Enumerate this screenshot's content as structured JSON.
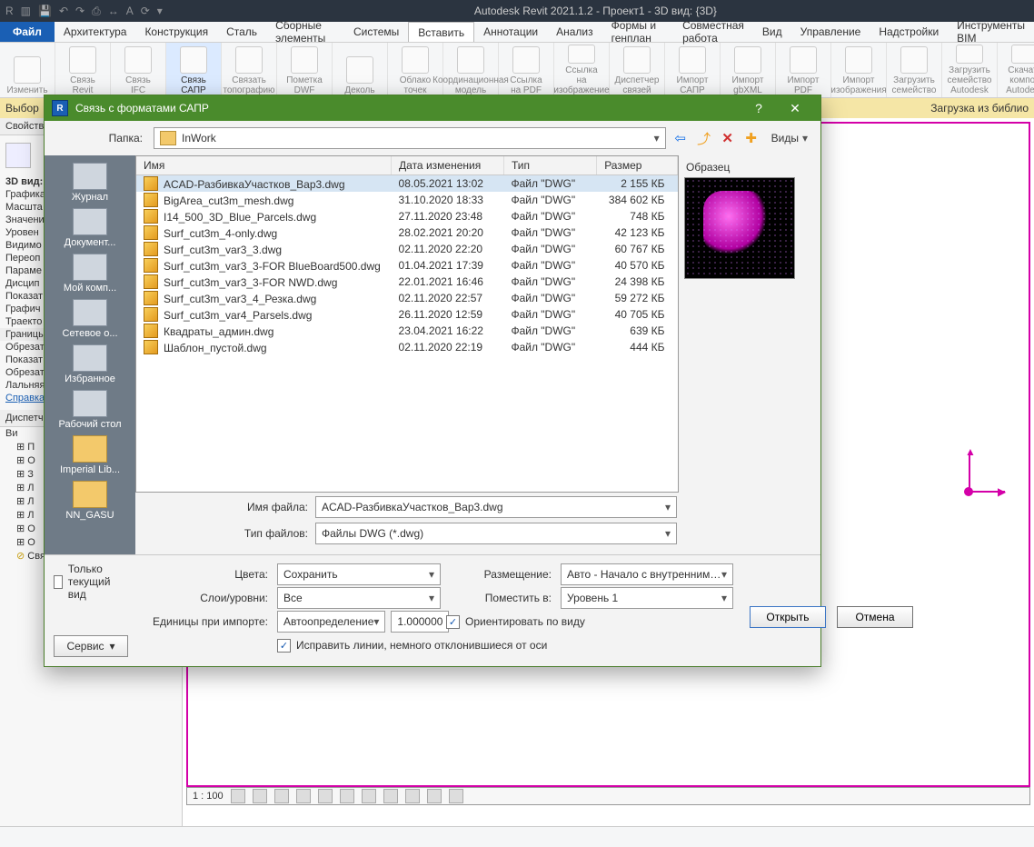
{
  "app_title": "Autodesk Revit 2021.1.2 - Проект1 - 3D вид: {3D}",
  "menu_file": "Файл",
  "menu_tabs": [
    "Архитектура",
    "Конструкция",
    "Сталь",
    "Сборные элементы",
    "Системы",
    "Вставить",
    "Аннотации",
    "Анализ",
    "Формы и генплан",
    "Совместная работа",
    "Вид",
    "Управление",
    "Надстройки",
    "Инструменты BIM"
  ],
  "menu_active_index": 5,
  "ribbon_items": [
    "Изменить",
    "Связь Revit",
    "Связь IFC",
    "Связь САПР",
    "Связать топографию",
    "Пометка DWF",
    "Деколь",
    "Облако точек",
    "Координационная модель",
    "Ссылка на PDF",
    "Ссылка на изображение",
    "Диспетчер связей",
    "Импорт САПР",
    "Импорт gbXML",
    "Импорт PDF",
    "Импорт изображения",
    "Загрузить семейство",
    "Загрузить семейство Autodesk",
    "Скачать компон Autodesk"
  ],
  "ribbon_active_index": 3,
  "options_bar_left": "Выбор",
  "options_bar_right": "Загрузка из библио",
  "left_panel": {
    "props_header": "Свойства",
    "view_label": "3D вид:",
    "rows": [
      "Графика",
      "Масшта",
      "Значени",
      "Уровен",
      "Видимо",
      "Переоп",
      "Параме",
      "Дисцип",
      "Показат",
      "Графич",
      "Траекто"
    ],
    "section": "Границы",
    "rows2": [
      "Обрезат",
      "Показат",
      "Обрезат",
      "Лальняя"
    ],
    "help_link": "Справка",
    "dispatch": "Диспетч",
    "tree_header": "Ви",
    "tree_nodes": [
      "П",
      "О",
      "З",
      "Л",
      "Л",
      "Л",
      "О",
      "О"
    ],
    "linked_label": "Связанные файлы Revit"
  },
  "view_scale": "1 : 100",
  "dialog": {
    "title": "Связь с форматами САПР",
    "folder_label": "Папка:",
    "folder_value": "InWork",
    "views_label": "Виды",
    "columns": [
      "Имя",
      "Дата изменения",
      "Тип",
      "Размер"
    ],
    "files": [
      {
        "name": "ACAD-РазбивкаУчастков_Вар3.dwg",
        "date": "08.05.2021 13:02",
        "type": "Файл \"DWG\"",
        "size": "2 155 КБ",
        "sel": true
      },
      {
        "name": "BigArea_cut3m_mesh.dwg",
        "date": "31.10.2020 18:33",
        "type": "Файл \"DWG\"",
        "size": "384 602 КБ"
      },
      {
        "name": "I14_500_3D_Blue_Parcels.dwg",
        "date": "27.11.2020 23:48",
        "type": "Файл \"DWG\"",
        "size": "748 КБ"
      },
      {
        "name": "Surf_cut3m_4-only.dwg",
        "date": "28.02.2021 20:20",
        "type": "Файл \"DWG\"",
        "size": "42 123 КБ"
      },
      {
        "name": "Surf_cut3m_var3_3.dwg",
        "date": "02.11.2020 22:20",
        "type": "Файл \"DWG\"",
        "size": "60 767 КБ"
      },
      {
        "name": "Surf_cut3m_var3_3-FOR BlueBoard500.dwg",
        "date": "01.04.2021 17:39",
        "type": "Файл \"DWG\"",
        "size": "40 570 КБ"
      },
      {
        "name": "Surf_cut3m_var3_3-FOR NWD.dwg",
        "date": "22.01.2021 16:46",
        "type": "Файл \"DWG\"",
        "size": "24 398 КБ"
      },
      {
        "name": "Surf_cut3m_var3_4_Резка.dwg",
        "date": "02.11.2020 22:57",
        "type": "Файл \"DWG\"",
        "size": "59 272 КБ"
      },
      {
        "name": "Surf_cut3m_var4_Parsels.dwg",
        "date": "26.11.2020 12:59",
        "type": "Файл \"DWG\"",
        "size": "40 705 КБ"
      },
      {
        "name": "Квадраты_админ.dwg",
        "date": "23.04.2021 16:22",
        "type": "Файл \"DWG\"",
        "size": "639 КБ"
      },
      {
        "name": "Шаблон_пустой.dwg",
        "date": "02.11.2020 22:19",
        "type": "Файл \"DWG\"",
        "size": "444 КБ"
      }
    ],
    "places": [
      "Журнал",
      "Документ...",
      "Мой комп...",
      "Сетевое о...",
      "Избранное",
      "Рабочий стол",
      "Imperial Lib...",
      "NN_GASU"
    ],
    "preview_label": "Образец",
    "filename_label": "Имя файла:",
    "filename_value": "ACAD-РазбивкаУчастков_Вар3.dwg",
    "filetype_label": "Тип файлов:",
    "filetype_value": "Файлы DWG  (*.dwg)",
    "only_current_view": "Только текущий вид",
    "service": "Сервис",
    "colors_label": "Цвета:",
    "colors_value": "Сохранить",
    "layers_label": "Слои/уровни:",
    "layers_value": "Все",
    "units_label": "Единицы при импорте:",
    "units_value": "Автоопределение",
    "units_factor": "1.000000",
    "placement_label": "Размещение:",
    "placement_value": "Авто - Начало с внутренним началом",
    "placein_label": "Поместить в:",
    "placein_value": "Уровень 1",
    "orient_label": "Ориентировать по виду",
    "fix_lines": "Исправить линии, немного отклонившиеся от оси",
    "open": "Открыть",
    "cancel": "Отмена"
  }
}
